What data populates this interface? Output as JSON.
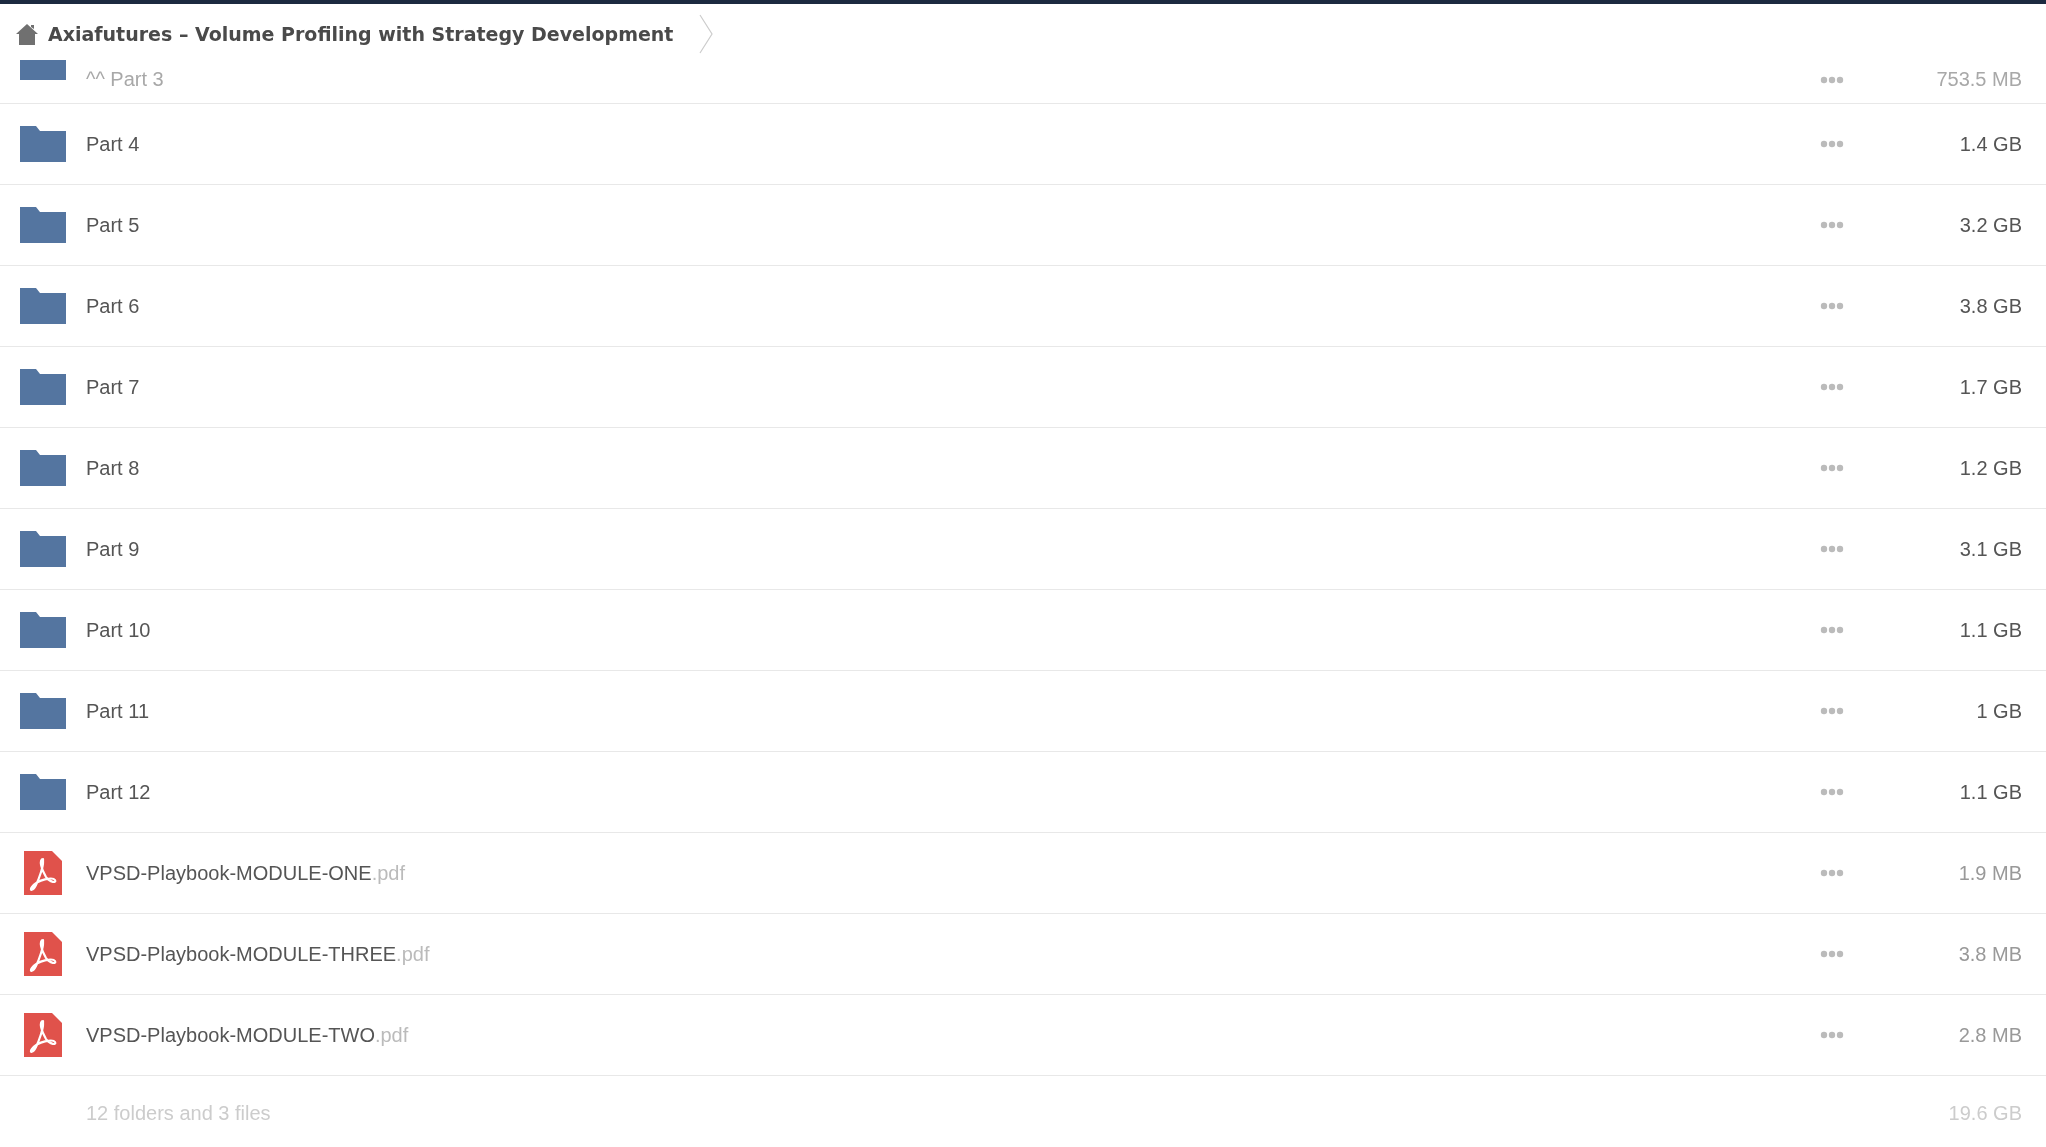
{
  "breadcrumb": {
    "title": "Axiafutures – Volume Profiling with Strategy Development"
  },
  "items": [
    {
      "kind": "folder",
      "name": "^^ Part 3",
      "size": "753.5 MB",
      "faded": true
    },
    {
      "kind": "folder",
      "name": "Part 4",
      "size": "1.4 GB",
      "faded": false
    },
    {
      "kind": "folder",
      "name": "Part 5",
      "size": "3.2 GB",
      "faded": false
    },
    {
      "kind": "folder",
      "name": "Part 6",
      "size": "3.8 GB",
      "faded": false
    },
    {
      "kind": "folder",
      "name": "Part 7",
      "size": "1.7 GB",
      "faded": false
    },
    {
      "kind": "folder",
      "name": "Part 8",
      "size": "1.2 GB",
      "faded": false
    },
    {
      "kind": "folder",
      "name": "Part 9",
      "size": "3.1 GB",
      "faded": false
    },
    {
      "kind": "folder",
      "name": "Part 10",
      "size": "1.1 GB",
      "faded": false
    },
    {
      "kind": "folder",
      "name": "Part 11",
      "size": "1 GB",
      "faded": false
    },
    {
      "kind": "folder",
      "name": "Part 12",
      "size": "1.1 GB",
      "faded": false
    },
    {
      "kind": "pdf",
      "name": "VPSD-Playbook-MODULE-ONE",
      "extension": ".pdf",
      "size": "1.9 MB",
      "faded": false
    },
    {
      "kind": "pdf",
      "name": "VPSD-Playbook-MODULE-THREE",
      "extension": ".pdf",
      "size": "3.8 MB",
      "faded": false
    },
    {
      "kind": "pdf",
      "name": "VPSD-Playbook-MODULE-TWO",
      "extension": ".pdf",
      "size": "2.8 MB",
      "faded": false
    }
  ],
  "footer": {
    "summary": "12 folders and 3 files",
    "total": "19.6 GB"
  }
}
